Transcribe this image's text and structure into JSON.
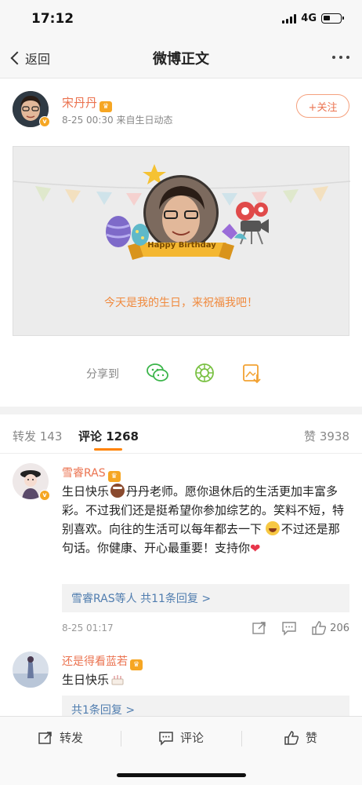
{
  "status_bar": {
    "time": "17:12",
    "network": "4G"
  },
  "nav": {
    "back_label": "返回",
    "title": "微博正文"
  },
  "post": {
    "user_name": "宋丹丹",
    "meta": "8-25 00:30  来自生日动态",
    "follow_label": "+关注",
    "card_ribbon": "Happy Birthday",
    "card_text": "今天是我的生日，来祝福我吧！",
    "share_label": "分享到"
  },
  "tabs": {
    "repost": "转发 143",
    "comments": "评论 1268",
    "likes": "赞 3938"
  },
  "comments": [
    {
      "name": "雪睿RAS",
      "text_1": "生日快乐",
      "text_2": "丹丹老师。愿你退休后的生活更加丰富多彩。不过我们还是挺希望你参加综艺的。笑料不短，特别喜欢。向往的生活可以每年都去一下",
      "text_3": "不过还是那句话。你健康、开心最重要！支持你",
      "reply_summary": "雪睿RAS等人  共11条回复 >",
      "date": "8-25 01:17",
      "like_count": "206"
    },
    {
      "name": "还是得看蓝若",
      "text": "生日快乐",
      "reply_summary": "共1条回复 >"
    }
  ],
  "bottom_bar": {
    "repost": "转发",
    "comment": "评论",
    "like": "赞"
  },
  "colors": {
    "accent": "#eb7350",
    "link": "#507daf",
    "card_text": "#f08a3e"
  }
}
